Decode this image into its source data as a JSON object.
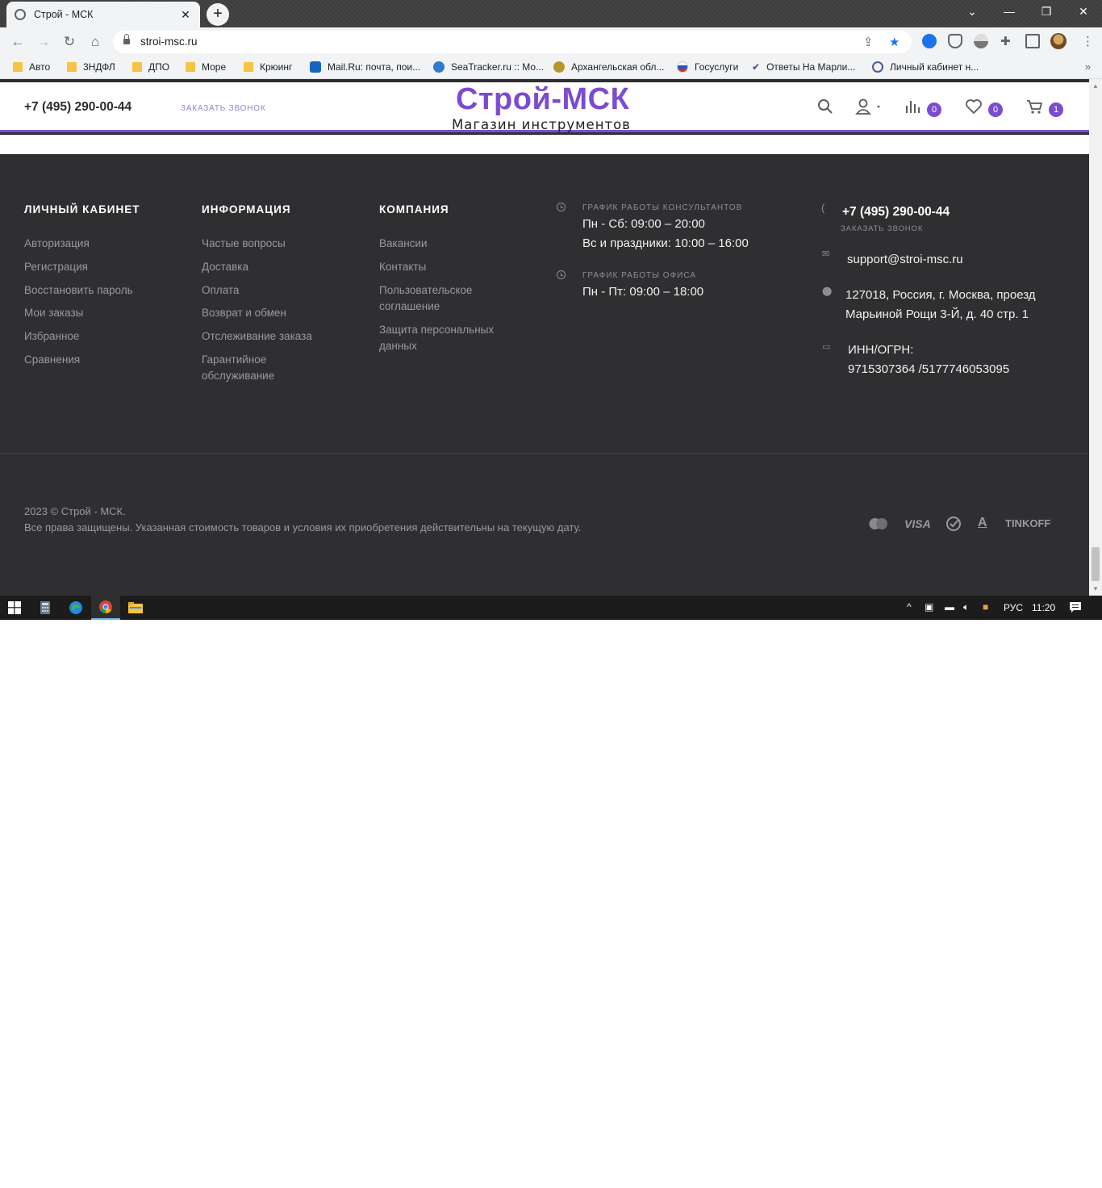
{
  "browser": {
    "tab_title": "Строй - МСК",
    "url": "stroi-msc.ru",
    "bookmarks": [
      "Авто",
      "3НДФЛ",
      "ДПО",
      "Море",
      "Крюинг",
      "Mail.Ru: почта, пои...",
      "SeaTracker.ru :: Мо...",
      "Архангельская обл...",
      "Госуслуги",
      "Ответы На Марли...",
      "Личный кабинет н..."
    ],
    "more_label": "»",
    "colors": {
      "bookmark_folder": "#f6c344",
      "bookmark_star": "#1a73e8"
    }
  },
  "header": {
    "phone": "+7 (495) 290-00-44",
    "callback": "ЗАКАЗАТЬ ЗВОНОК",
    "logo_title": "Строй-МСК",
    "logo_subtitle": "Магазин инструментов",
    "compare_count": "0",
    "favorites_count": "0",
    "cart_count": "1",
    "accent_color": "#7c4ccf"
  },
  "footer": {
    "account": {
      "title": "ЛИЧНЫЙ КАБИНЕТ",
      "links": [
        "Авторизация",
        "Регистрация",
        "Восстановить пароль",
        "Мои заказы",
        "Избранное",
        "Сравнения"
      ]
    },
    "info": {
      "title": "ИНФОРМАЦИЯ",
      "links": [
        "Частые вопросы",
        "Доставка",
        "Оплата",
        "Возврат и обмен",
        "Отслеживание заказа",
        "Гарантийное обслуживание"
      ]
    },
    "company": {
      "title": "КОМПАНИЯ",
      "links": [
        "Вакансии",
        "Контакты",
        "Пользовательское соглашение",
        "Защита персональных данных"
      ]
    },
    "schedule": {
      "consultants_label": "ГРАФИК РАБОТЫ КОНСУЛЬТАНТОВ",
      "consultants_line1": "Пн - Сб: 09:00 – 20:00",
      "consultants_line2": "Вс и праздники: 10:00 – 16:00",
      "office_label": "ГРАФИК РАБОТЫ ОФИСА",
      "office_line1": "Пн - Пт: 09:00 – 18:00"
    },
    "contacts": {
      "phone": "+7 (495) 290-00-44",
      "callback": "ЗАКАЗАТЬ ЗВОНОК",
      "email": "support@stroi-msc.ru",
      "address_line1": "127018, Россия, г. Москва, проезд",
      "address_line2": "Марьиной Рощи 3-Й, д. 40 стр. 1",
      "inn_label": "ИНН/ОГРН:",
      "inn_value": "9715307364 /5177746053095"
    },
    "copyright_line1": "2023 © Строй - МСК.",
    "copyright_line2": "Все права защищены. Указанная стоимость товаров и условия их приобретения действительны на текущую дату.",
    "payment_visa": "VISA",
    "payment_alfa": "A",
    "payment_tinkoff": "TINKOFF",
    "background_color": "#2f2f31"
  },
  "taskbar": {
    "language": "РУС",
    "time": "11:20"
  }
}
